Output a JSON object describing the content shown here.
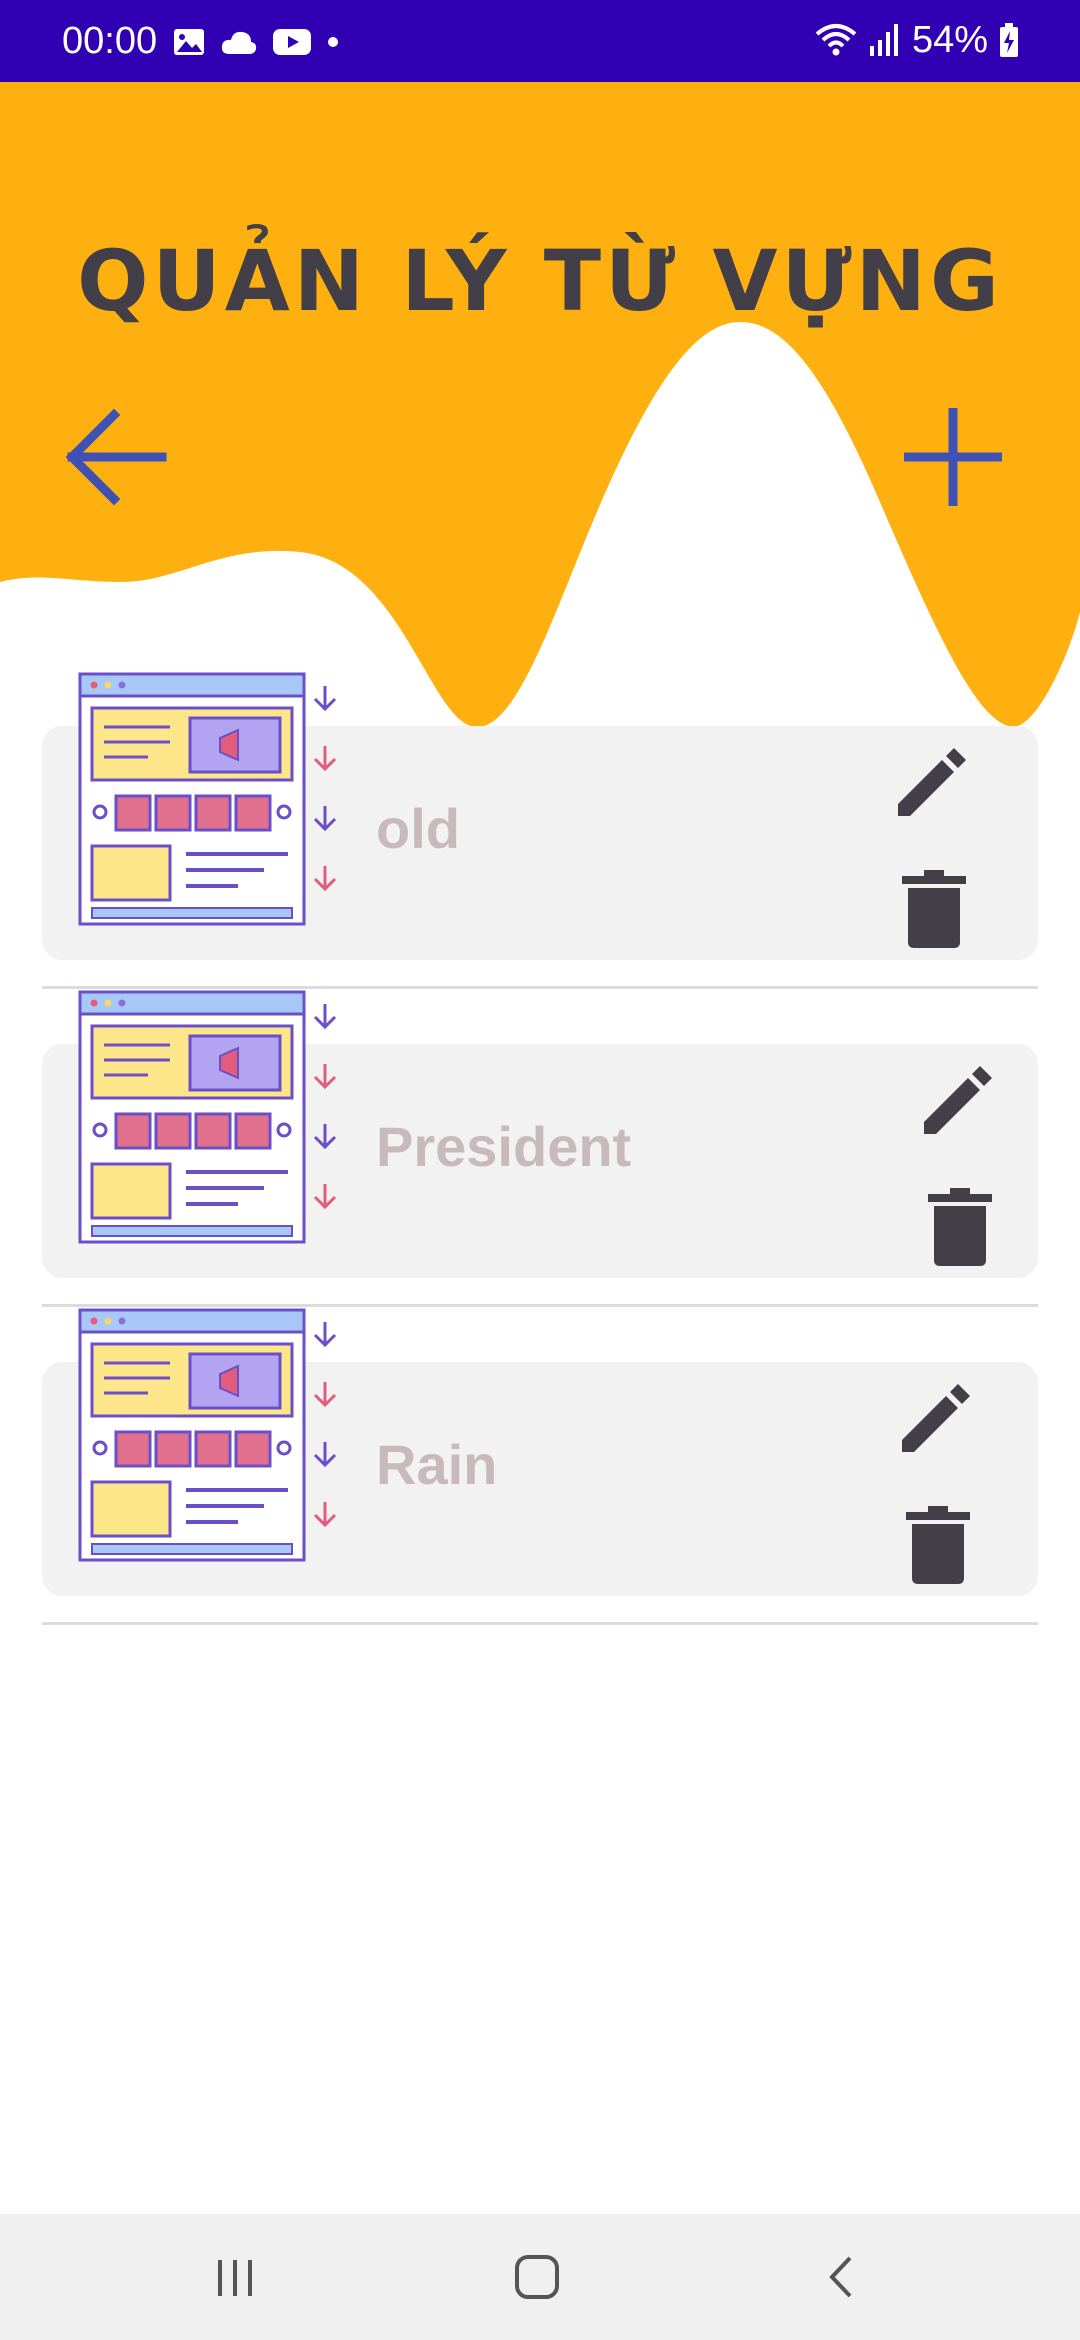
{
  "status_bar": {
    "time": "00:00",
    "battery": "54%",
    "background": "#3200b3",
    "left_icons": [
      "gallery-icon",
      "cloud-icon",
      "youtube-icon",
      "dot-icon"
    ],
    "right_icons": [
      "wifi-icon",
      "signal-icon",
      "battery-charging-icon"
    ]
  },
  "header": {
    "title": "QUẢN LÝ TỪ VỰNG",
    "background": "#ffb011",
    "back_icon": "arrow-left-icon",
    "add_icon": "plus-icon",
    "icon_color": "#3f51b5"
  },
  "vocabulary": {
    "items": [
      {
        "word": "old",
        "image": "web-layout-illustration",
        "edit_icon": "pencil-icon",
        "delete_icon": "trash-icon"
      },
      {
        "word": "President",
        "image": "web-layout-illustration",
        "edit_icon": "pencil-icon",
        "delete_icon": "trash-icon"
      },
      {
        "word": "Rain",
        "image": "web-layout-illustration",
        "edit_icon": "pencil-icon",
        "delete_icon": "trash-icon"
      }
    ]
  },
  "nav_bar": {
    "buttons": [
      "recent-apps-icon",
      "home-icon",
      "back-icon"
    ]
  }
}
